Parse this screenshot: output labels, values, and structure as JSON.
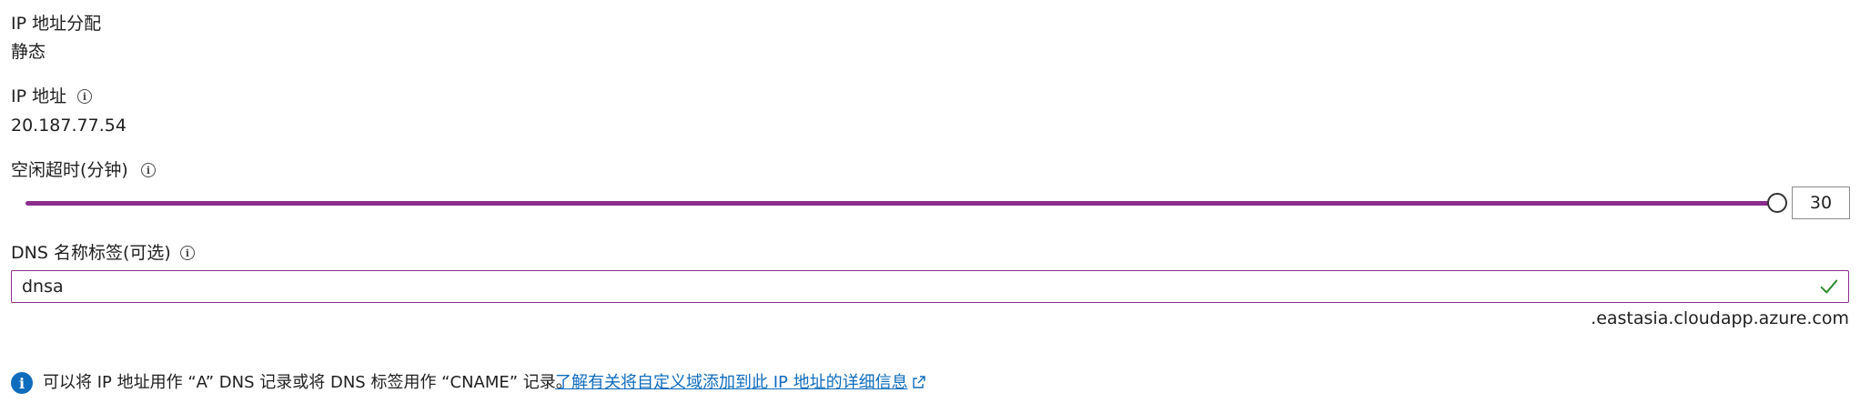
{
  "ip_assignment": {
    "label": "IP 地址分配",
    "value": "静态"
  },
  "ip_address": {
    "label": "IP 地址",
    "value": "20.187.77.54",
    "info_icon": "info-icon"
  },
  "idle_timeout": {
    "label": "空闲超时(分钟)",
    "value": "30",
    "fraction": 1.0,
    "accent_color": "#8b2d8b"
  },
  "dns_label": {
    "label": "DNS 名称标签(可选)",
    "value": "dnsa",
    "suffix": ".eastasia.cloudapp.azure.com",
    "valid_icon": "checkmark-icon"
  },
  "info_bar": {
    "text": "可以将 IP 地址用作 “A” DNS 记录或将 DNS 标签用作 “CNAME” 记录。",
    "link_text": "了解有关将自定义域添加到此 IP 地址的详细信息",
    "icon": "info-filled-icon",
    "link_icon": "external-link-icon"
  },
  "colors": {
    "accent": "#8b2d8b",
    "link": "#0f6cbd",
    "check": "#2e8b2e"
  }
}
